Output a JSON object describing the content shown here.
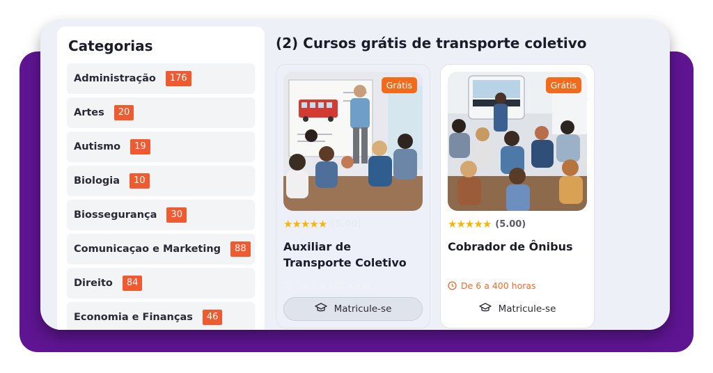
{
  "sidebar": {
    "title": "Categorias",
    "items": [
      {
        "label": "Administração",
        "count": "176"
      },
      {
        "label": "Artes",
        "count": "20"
      },
      {
        "label": "Autismo",
        "count": "19"
      },
      {
        "label": "Biologia",
        "count": "10"
      },
      {
        "label": "Biossegurança",
        "count": "30"
      },
      {
        "label": "Comunicaçao e Marketing",
        "count": "88"
      },
      {
        "label": "Direito",
        "count": "84"
      },
      {
        "label": "Economia e Finanças",
        "count": "46"
      }
    ]
  },
  "main": {
    "title": "(2) Cursos grátis de transporte coletivo",
    "cards": [
      {
        "badge": "Grátis",
        "rating": "(5.00)",
        "stars": 5,
        "title": "Auxiliar de Transporte Coletivo",
        "hours": "De 6 a 400 horas",
        "enroll": "Matricule-se"
      },
      {
        "badge": "Grátis",
        "rating": "(5.00)",
        "stars": 5,
        "title": "Cobrador de Ônibus",
        "hours": "De 6 a 400 horas",
        "enroll": "Matricule-se"
      }
    ]
  },
  "colors": {
    "accent": "#ef5a31",
    "purple": "#5f1592",
    "star": "#f5b50a"
  }
}
